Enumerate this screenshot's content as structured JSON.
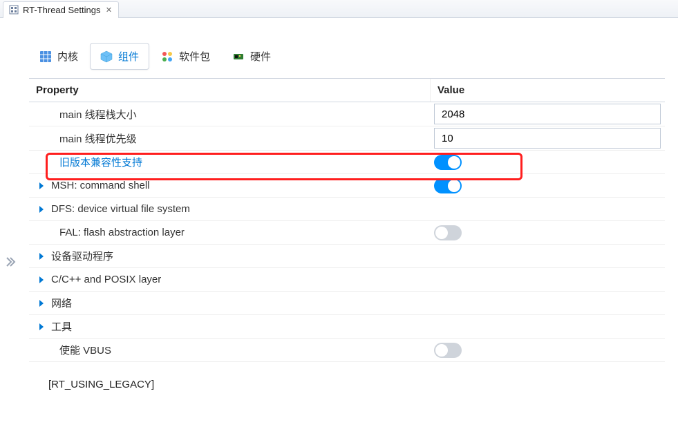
{
  "window": {
    "tab_title": "RT-Thread Settings"
  },
  "nav": {
    "items": [
      {
        "label": "内核"
      },
      {
        "label": "组件"
      },
      {
        "label": "软件包"
      },
      {
        "label": "硬件"
      }
    ]
  },
  "columns": {
    "property": "Property",
    "value": "Value"
  },
  "rows": [
    {
      "label": "main 线程栈大小",
      "value_type": "input",
      "value": "2048",
      "expandable": false,
      "highlighted": false
    },
    {
      "label": "main 线程优先级",
      "value_type": "input",
      "value": "10",
      "expandable": false,
      "highlighted": false
    },
    {
      "label": "旧版本兼容性支持",
      "value_type": "toggle",
      "value": "on",
      "expandable": false,
      "highlighted": true
    },
    {
      "label": "MSH: command shell",
      "value_type": "toggle",
      "value": "on",
      "expandable": true,
      "highlighted": false
    },
    {
      "label": "DFS: device virtual file system",
      "value_type": "none",
      "value": "",
      "expandable": true,
      "highlighted": false
    },
    {
      "label": "FAL: flash abstraction layer",
      "value_type": "toggle",
      "value": "off",
      "expandable": false,
      "highlighted": false
    },
    {
      "label": "设备驱动程序",
      "value_type": "none",
      "value": "",
      "expandable": true,
      "highlighted": false
    },
    {
      "label": "C/C++ and POSIX layer",
      "value_type": "none",
      "value": "",
      "expandable": true,
      "highlighted": false
    },
    {
      "label": "网络",
      "value_type": "none",
      "value": "",
      "expandable": true,
      "highlighted": false
    },
    {
      "label": "工具",
      "value_type": "none",
      "value": "",
      "expandable": true,
      "highlighted": false
    },
    {
      "label": "使能 VBUS",
      "value_type": "toggle",
      "value": "off",
      "expandable": false,
      "highlighted": false
    }
  ],
  "status": {
    "text": "[RT_USING_LEGACY]"
  }
}
